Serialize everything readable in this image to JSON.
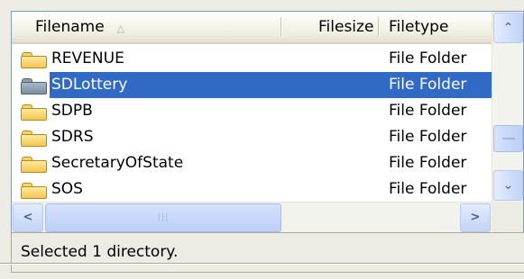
{
  "columns": {
    "filename": "Filename",
    "sort_indicator": "△",
    "filesize": "Filesize",
    "filetype": "Filetype"
  },
  "rows": [
    {
      "name": "REVENUE",
      "size": "",
      "type": "File Folder",
      "selected": false
    },
    {
      "name": "SDLottery",
      "size": "",
      "type": "File Folder",
      "selected": true
    },
    {
      "name": "SDPB",
      "size": "",
      "type": "File Folder",
      "selected": false
    },
    {
      "name": "SDRS",
      "size": "",
      "type": "File Folder",
      "selected": false
    },
    {
      "name": "SecretaryOfState",
      "size": "",
      "type": "File Folder",
      "selected": false
    },
    {
      "name": "SOS",
      "size": "",
      "type": "File Folder",
      "selected": false
    }
  ],
  "scroll": {
    "up_glyph": "⌃",
    "down_glyph": "⌄",
    "left_glyph": "<",
    "right_glyph": ">",
    "grip": "|||"
  },
  "status": {
    "text": "Selected 1 directory."
  },
  "colors": {
    "selection": "#316ac5",
    "folder": "#f3c650"
  }
}
